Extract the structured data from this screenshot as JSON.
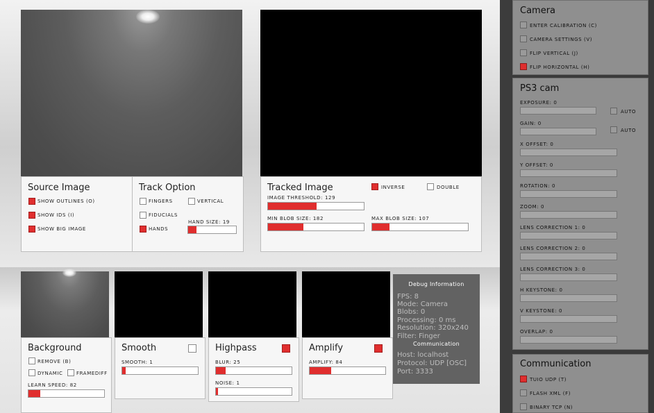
{
  "source_panel": {
    "title": "Source Image",
    "options": [
      {
        "label": "SHOW OUTLINES (O)",
        "checked": true
      },
      {
        "label": "SHOW IDS (I)",
        "checked": true
      },
      {
        "label": "SHOW BIG IMAGE",
        "checked": true
      }
    ]
  },
  "track_panel": {
    "title": "Track Option",
    "fingers": {
      "label": "FINGERS",
      "checked": false
    },
    "vertical": {
      "label": "VERTICAL",
      "checked": false
    },
    "fiducials": {
      "label": "FIDUCIALS",
      "checked": false
    },
    "hands": {
      "label": "HANDS",
      "checked": true
    },
    "hand_size": {
      "label": "HAND SIZE: 19",
      "fraction": 0.18
    }
  },
  "tracked_panel": {
    "title": "Tracked Image",
    "inverse": {
      "label": "INVERSE",
      "checked": true
    },
    "double": {
      "label": "DOUBLE",
      "checked": false
    },
    "image_threshold": {
      "label": "IMAGE THRESHOLD: 129",
      "fraction": 0.51
    },
    "min_blob": {
      "label": "MIN BLOB SIZE: 182",
      "fraction": 0.37
    },
    "max_blob": {
      "label": "MAX BLOB SIZE: 107",
      "fraction": 0.18
    }
  },
  "background_panel": {
    "title": "Background",
    "remove": {
      "label": "REMOVE (B)",
      "checked": false
    },
    "dynamic": {
      "label": "DYNAMIC",
      "checked": false
    },
    "framediff": {
      "label": "FRAMEDIFF",
      "checked": false
    },
    "learn_speed": {
      "label": "LEARN SPEED: 82",
      "fraction": 0.16
    }
  },
  "smooth_panel": {
    "title": "Smooth",
    "enabled": false,
    "smooth": {
      "label": "SMOOTH: 1",
      "fraction": 0.05
    }
  },
  "highpass_panel": {
    "title": "Highpass",
    "enabled": true,
    "blur": {
      "label": "BLUR: 25",
      "fraction": 0.13
    },
    "noise": {
      "label": "NOISE: 1",
      "fraction": 0.03
    }
  },
  "amplify_panel": {
    "title": "Amplify",
    "enabled": true,
    "amplify": {
      "label": "AMPLIFY: 84",
      "fraction": 0.28
    }
  },
  "debug": {
    "header": "Debug Information",
    "fps": "FPS:  8",
    "mode": "Mode:  Camera",
    "blobs": "Blobs:  0",
    "processing": "Processing:  0  ms",
    "resolution": "Resolution:  320x240",
    "filter": "Filter:  Finger",
    "comm_header": "Communication",
    "host": "Host:  localhost",
    "protocol": "Protocol:  UDP [OSC]",
    "port": "Port:  3333"
  },
  "sidebar": {
    "camera": {
      "title": "Camera",
      "items": [
        {
          "label": "ENTER CALIBRATION (C)",
          "checked": false
        },
        {
          "label": "CAMERA SETTINGS (V)",
          "checked": false
        },
        {
          "label": "FLIP VERTICAL (J)",
          "checked": false
        },
        {
          "label": "FLIP HORIZONTAL (H)",
          "checked": true
        }
      ]
    },
    "ps3": {
      "title": "PS3 cam",
      "auto_label": "AUTO",
      "sliders": [
        {
          "label": "EXPOSURE: 0",
          "auto": true
        },
        {
          "label": "GAIN: 0",
          "auto": true
        },
        {
          "label": "X OFFSET: 0"
        },
        {
          "label": "Y OFFSET: 0"
        },
        {
          "label": "ROTATION: 0"
        },
        {
          "label": "ZOOM: 0"
        },
        {
          "label": "LENS CORRECTION 1: 0"
        },
        {
          "label": "LENS CORRECTION 2: 0"
        },
        {
          "label": "LENS CORRECTION 3: 0"
        },
        {
          "label": "H KEYSTONE: 0"
        },
        {
          "label": "V KEYSTONE: 0"
        },
        {
          "label": "OVERLAP: 0"
        }
      ]
    },
    "communication": {
      "title": "Communication",
      "items": [
        {
          "label": "TUIO UDP (T)",
          "checked": true
        },
        {
          "label": "FLASH XML (F)",
          "checked": false
        },
        {
          "label": "BINARY TCP (N)",
          "checked": false
        }
      ]
    }
  },
  "colors": {
    "accent": "#e02e2e",
    "sidebar_bg": "#3a3a3a",
    "sidebar_panel": "#8f8f8f",
    "debug_bg": "#626262"
  }
}
